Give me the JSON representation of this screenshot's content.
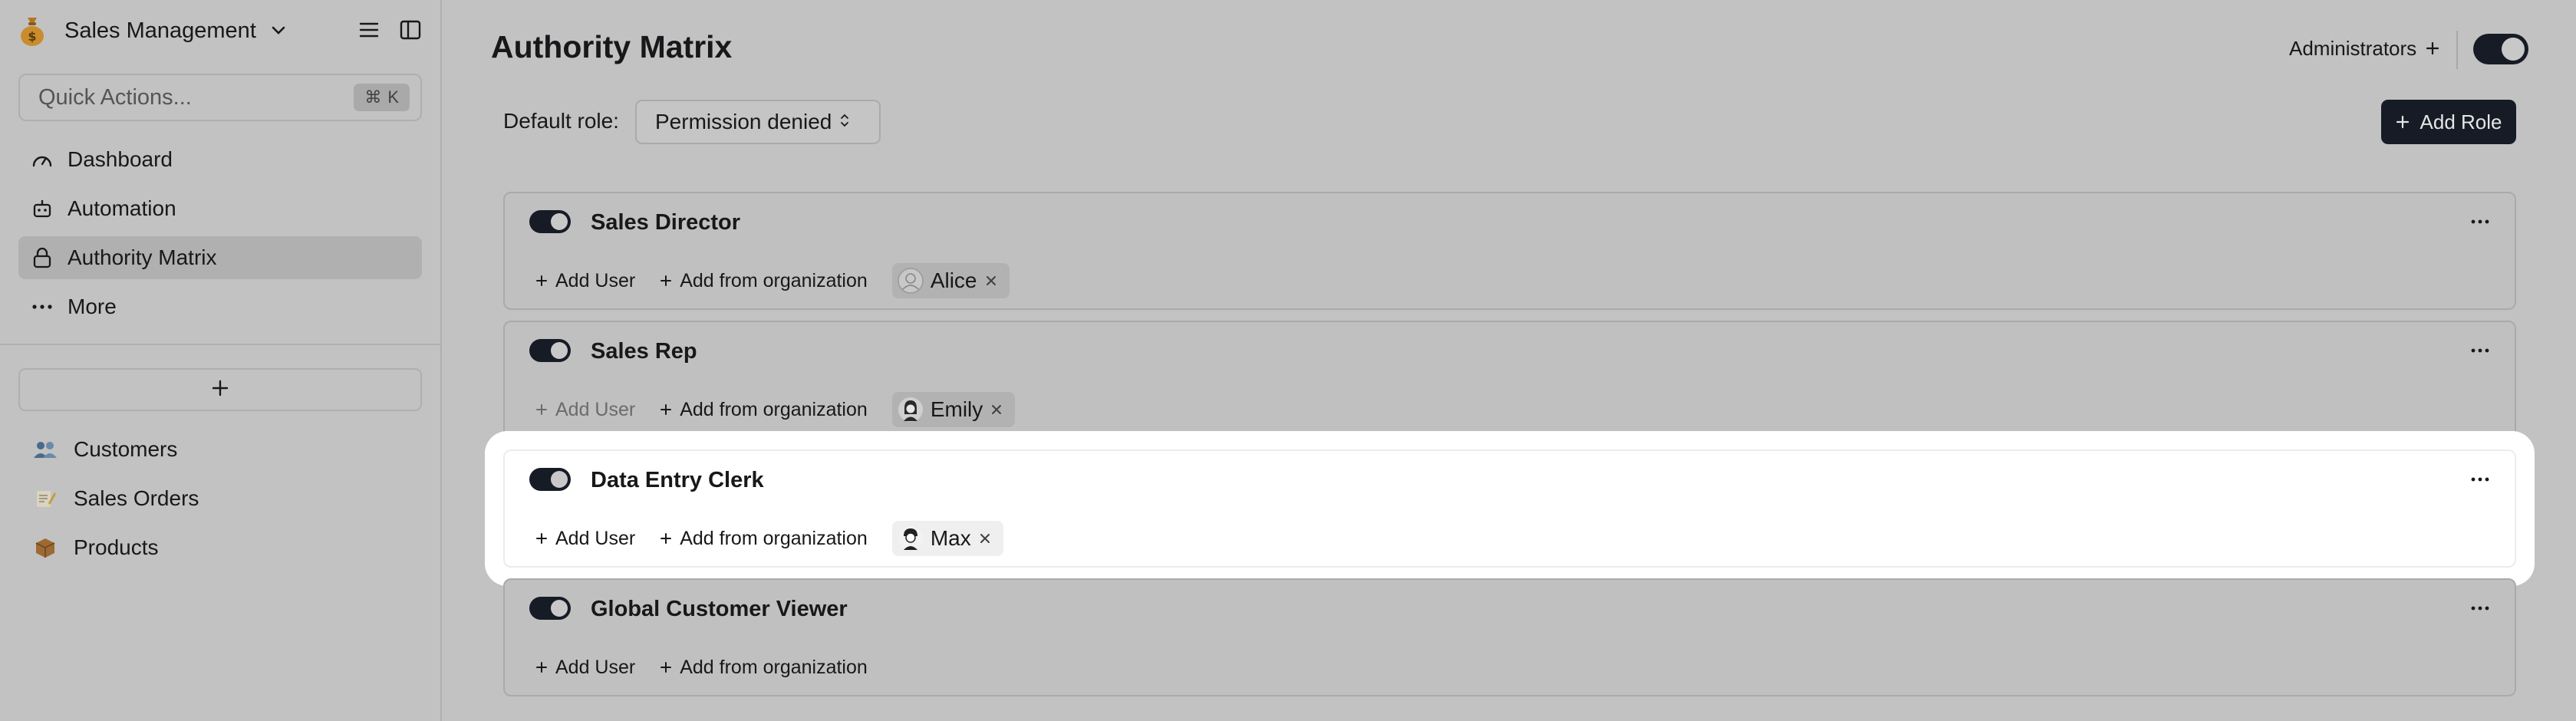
{
  "sidebar": {
    "workspace": "Sales Management",
    "quick_actions": {
      "placeholder": "Quick Actions...",
      "shortcut_symbol": "⌘",
      "shortcut_key": "K"
    },
    "nav": [
      {
        "label": "Dashboard",
        "icon": "gauge-icon",
        "active": false
      },
      {
        "label": "Automation",
        "icon": "robot-icon",
        "active": false
      },
      {
        "label": "Authority Matrix",
        "icon": "lock-icon",
        "active": true
      },
      {
        "label": "More",
        "icon": "ellipsis-icon",
        "active": false
      }
    ],
    "collections": [
      {
        "label": "Customers",
        "emoji": "👥"
      },
      {
        "label": "Sales Orders",
        "emoji": "📝"
      },
      {
        "label": "Products",
        "emoji": "📦"
      }
    ]
  },
  "main": {
    "title": "Authority Matrix",
    "administrators_label": "Administrators",
    "default_role_label": "Default role:",
    "default_role_value": "Permission denied",
    "add_role_label": "Add Role",
    "roles": [
      {
        "name": "Sales Director",
        "enabled": true,
        "add_user": "Add User",
        "add_org": "Add from organization",
        "users": [
          "Alice"
        ]
      },
      {
        "name": "Sales Rep",
        "enabled": true,
        "add_user": "Add User",
        "add_org": "Add from organization",
        "users": [
          "Emily"
        ]
      },
      {
        "name": "Data Entry Clerk",
        "enabled": true,
        "add_user": "Add User",
        "add_org": "Add from organization",
        "users": [
          "Max"
        ],
        "highlighted": true
      },
      {
        "name": "Global Customer Viewer",
        "enabled": true,
        "add_user": "Add User",
        "add_org": "Add from organization",
        "users": []
      }
    ]
  },
  "colors": {
    "accent": "#171b26",
    "dimmed_background": "#c2c2c2",
    "highlight": "#ffffff"
  }
}
